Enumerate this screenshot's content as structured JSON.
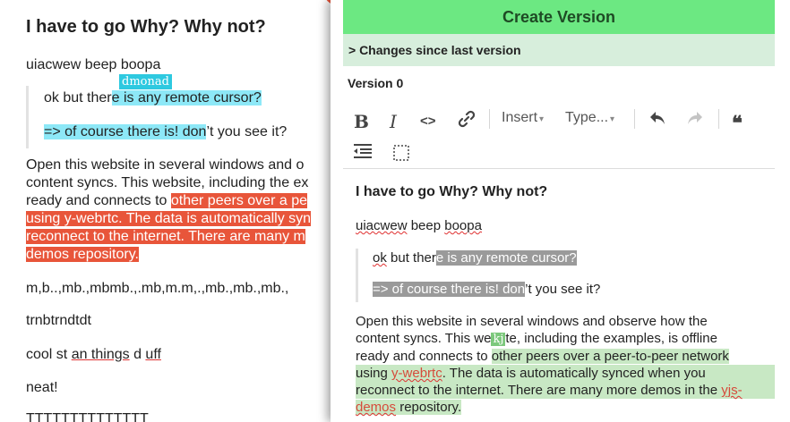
{
  "left_editor": {
    "title": "I have to go Why? Why not?",
    "line1": "uiacwew beep boopa",
    "quote1_prefix": "ok but ther",
    "quote1_highlight": "e is any remote cursor?",
    "remote_cursor_name": "dmonad",
    "quote2_highlight": "=> of course there is! don",
    "quote2_suffix": "’t you see it?",
    "para_l1": "Open this website in several windows and o",
    "para_l2": "content syncs. This website, including the ex",
    "para_l3_plain": "ready and connects to ",
    "para_l3_hl": "other peers over a pe",
    "para_l4_hl": "using y-webrtc. The data is automatically syn",
    "para_l5_hl": "reconnect to the internet. There are many m",
    "para_l6_hl": "demos repository.",
    "line_mb": "m,b..,mb.,mbmb.,.mb,m.m,.,mb.,mb.,mb.,",
    "line_trn": "trnbtrndtdt",
    "cool_prefix": "cool st ",
    "cool_an_things": "an things",
    "cool_d": " d ",
    "cool_uff": "uff",
    "neat": "neat!",
    "bottom_text": "TTTTTTTTTTTTTT"
  },
  "panel": {
    "create_version_label": "Create Version",
    "changes_label": "> Changes since last version",
    "version_label": "Version 0"
  },
  "toolbar": {
    "bold": "B",
    "italic": "I",
    "code": "<>",
    "link": "🔗",
    "insert_label": "Insert",
    "type_label": "Type...",
    "undo": "↶",
    "redo": "↷",
    "quote": "❝",
    "outdent": "☰",
    "select": "⬚",
    "icons": [
      "bold-icon",
      "italic-icon",
      "code-icon",
      "link-icon",
      "undo-icon",
      "redo-icon",
      "blockquote-icon",
      "outdent-icon",
      "select-node-icon"
    ]
  },
  "version_preview": {
    "title": "I have to go Why? Why not?",
    "line1_a": "uiacwew",
    "line1_b": " beep ",
    "line1_c": "boopa",
    "q1_a": "ok",
    "q1_b": " but ther",
    "q1_hl": "e is any remote cursor?",
    "q2_hl": "=> of course there is! don",
    "q2_suffix": "’t you see it?",
    "p_l1": "Open this website in several windows and observe how the",
    "p_l2_a": "content syncs. This we",
    "p_l2_tag": "kj",
    "p_l2_b": "te, including the examples, is offline",
    "p_l3_plain": "ready and connects to ",
    "p_l3_hl": "other peers over a peer-to-peer network",
    "p_l4_a": "using ",
    "p_l4_red": "y-webrtc",
    "p_l4_b": ". The data is automatically synced when you",
    "p_l5_a": "reconnect to the internet. There are many more demos in the ",
    "p_l5_red": "yjs-",
    "p_l6_red": "demos",
    "p_l6_b": " repository."
  },
  "colors": {
    "create_version_bg": "#6ce882",
    "changes_bg": "#d7eedc",
    "cursor_cyan": "#8de8f7",
    "remote_red": "#e8553a",
    "diff_green": "#c8e8c4",
    "diff_grey": "#9a9a9a"
  }
}
